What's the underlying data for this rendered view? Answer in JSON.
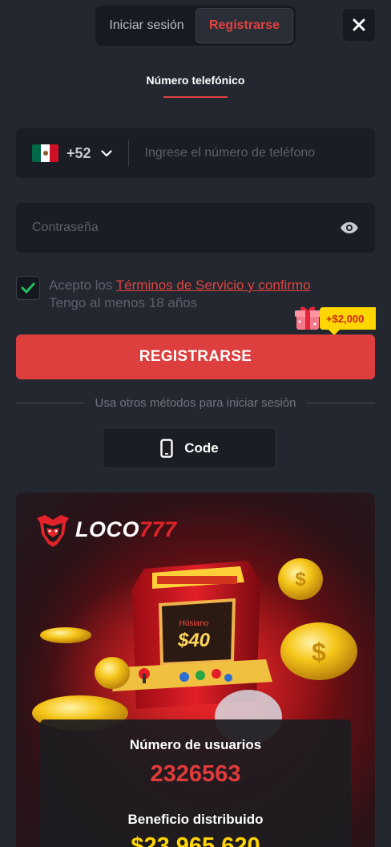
{
  "tabs": {
    "login": "Iniciar sesión",
    "register": "Registrarse"
  },
  "method": {
    "label": "Número telefónico"
  },
  "phone": {
    "country_code": "+52",
    "placeholder": "Ingrese el número de teléfono",
    "flag_colors": [
      "#006847",
      "#ffffff",
      "#ce1126"
    ]
  },
  "password": {
    "placeholder": "Contraseña"
  },
  "terms": {
    "prefix": "Acepto los ",
    "link": "Términos de Servicio y confirmo",
    "suffix": "Tengo al menos 18 años",
    "checked": true
  },
  "bonus": {
    "amount": "+$2,000"
  },
  "register_button": {
    "label": "REGISTRARSE"
  },
  "other_methods": {
    "label": "Usa otros métodos para iniciar sesión",
    "code_button": "Code"
  },
  "promo": {
    "brand_white": "LOCO",
    "brand_red": "777",
    "screen_label": "Húsiano",
    "screen_value": "$40",
    "users_label": "Número de usuarios",
    "users_value": "2326563",
    "profit_label": "Beneficio distribuido",
    "profit_value": "$23,965,620"
  },
  "colors": {
    "accent": "#dd3e3e",
    "background": "#232730",
    "field": "#1a1d24",
    "bonus": "#ffd600"
  }
}
